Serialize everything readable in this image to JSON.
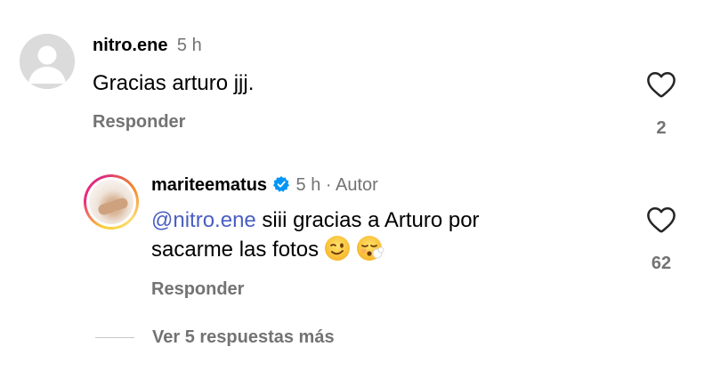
{
  "comments": [
    {
      "username": "nitro.ene",
      "time": "5 h",
      "text": "Gracias arturo jjj.",
      "reply_label": "Responder",
      "likes": "2"
    }
  ],
  "reply": {
    "username": "mariteematus",
    "time": "5 h · Autor",
    "mention": "@nitro.ene",
    "text_line1_rest": " siii gracias a Arturo por",
    "text_line2": "sacarme las fotos",
    "reply_label": "Responder",
    "likes": "62"
  },
  "more_replies": "Ver 5 respuestas más",
  "colors": {
    "secondary_text": "#737373",
    "mention": "#4a5fc1",
    "verified": "#0095f6"
  }
}
